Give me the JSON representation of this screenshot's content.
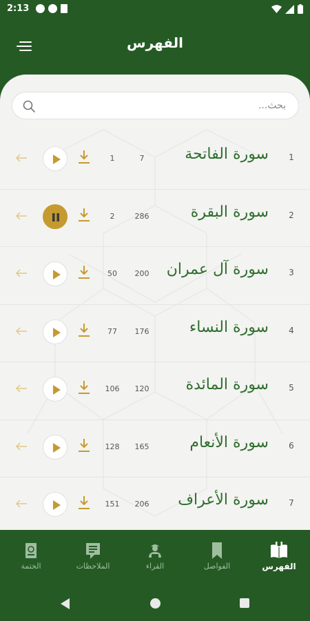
{
  "status_bar": {
    "time": "2:13"
  },
  "header": {
    "title": "الفهرس"
  },
  "search": {
    "placeholder": "بحث..."
  },
  "surahs": [
    {
      "number": "1",
      "name": "سورة الفاتحة",
      "ayat": "7",
      "page": "1",
      "playing": false
    },
    {
      "number": "2",
      "name": "سورة البقرة",
      "ayat": "286",
      "page": "2",
      "playing": true
    },
    {
      "number": "3",
      "name": "سورة آل عمران",
      "ayat": "200",
      "page": "50",
      "playing": false
    },
    {
      "number": "4",
      "name": "سورة النساء",
      "ayat": "176",
      "page": "77",
      "playing": false
    },
    {
      "number": "5",
      "name": "سورة المائدة",
      "ayat": "120",
      "page": "106",
      "playing": false
    },
    {
      "number": "6",
      "name": "سورة الأنعام",
      "ayat": "165",
      "page": "128",
      "playing": false
    },
    {
      "number": "7",
      "name": "سورة الأعراف",
      "ayat": "206",
      "page": "151",
      "playing": false
    }
  ],
  "bottom_nav": {
    "index": "الفهرس",
    "bookmarks": "الفواصل",
    "reciters": "القراء",
    "notes": "الملاحظات",
    "khatma": "الختمة"
  },
  "colors": {
    "primary": "#255a25",
    "accent_gold": "#c59a2f",
    "surah_name": "#2e6e2e",
    "background": "#f3f3f1"
  }
}
